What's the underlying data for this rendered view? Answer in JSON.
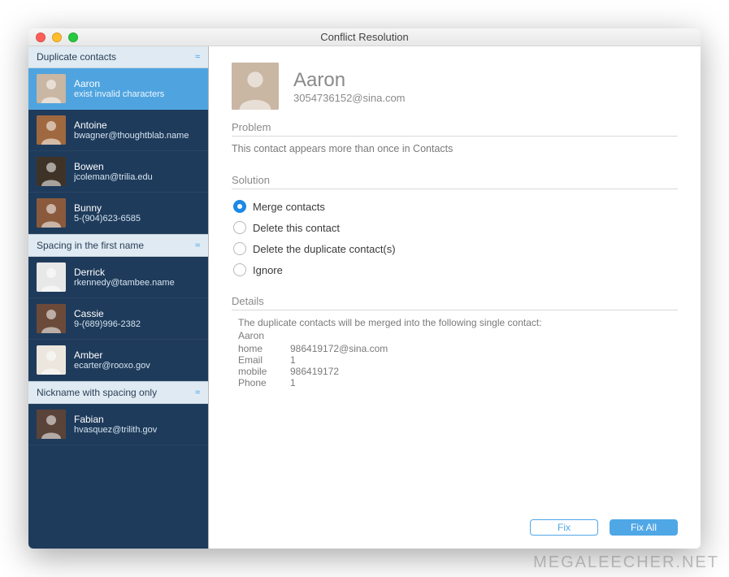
{
  "window": {
    "title": "Conflict Resolution"
  },
  "sidebar": {
    "groups": [
      {
        "label": "Duplicate contacts",
        "items": [
          {
            "name": "Aaron",
            "sub": "exist invalid characters",
            "selected": true,
            "avatar_bg": "#c9b6a3"
          },
          {
            "name": "Antoine",
            "sub": "bwagner@thoughtblab.name",
            "selected": false,
            "avatar_bg": "#a0683f"
          },
          {
            "name": "Bowen",
            "sub": "jcoleman@trilia.edu",
            "selected": false,
            "avatar_bg": "#3f3328"
          },
          {
            "name": "Bunny",
            "sub": "5-(904)623-6585",
            "selected": false,
            "avatar_bg": "#8b5a3c"
          }
        ]
      },
      {
        "label": "Spacing in the first name",
        "items": [
          {
            "name": "Derrick",
            "sub": "rkennedy@tambee.name",
            "selected": false,
            "avatar_bg": "#e8e8e8"
          },
          {
            "name": "Cassie",
            "sub": "9-(689)996-2382",
            "selected": false,
            "avatar_bg": "#6b4a3a"
          },
          {
            "name": "Amber",
            "sub": "ecarter@rooxo.gov",
            "selected": false,
            "avatar_bg": "#ece6de"
          }
        ]
      },
      {
        "label": "Nickname with spacing only",
        "items": [
          {
            "name": "Fabian",
            "sub": "hvasquez@trilith.gov",
            "selected": false,
            "avatar_bg": "#5a4338"
          }
        ]
      }
    ]
  },
  "main": {
    "hero": {
      "name": "Aaron",
      "sub": "3054736152@sina.com",
      "avatar_bg": "#c9b6a3"
    },
    "problem": {
      "heading": "Problem",
      "text": "This contact appears more than once in Contacts"
    },
    "solution": {
      "heading": "Solution",
      "options": [
        {
          "label": "Merge contacts",
          "checked": true
        },
        {
          "label": "Delete this contact",
          "checked": false
        },
        {
          "label": "Delete the duplicate contact(s)",
          "checked": false
        },
        {
          "label": "Ignore",
          "checked": false
        }
      ]
    },
    "details": {
      "heading": "Details",
      "intro": "The duplicate contacts will be merged into the following single contact:",
      "name": "Aaron",
      "rows": [
        {
          "label": "home",
          "value": "986419172@sina.com"
        },
        {
          "label": "Email",
          "value": "1"
        },
        {
          "label": "mobile",
          "value": "986419172"
        },
        {
          "label": "Phone",
          "value": "1"
        }
      ]
    },
    "buttons": {
      "fix": "Fix",
      "fix_all": "Fix All"
    }
  },
  "watermark": "MEGALEECHER.NET"
}
